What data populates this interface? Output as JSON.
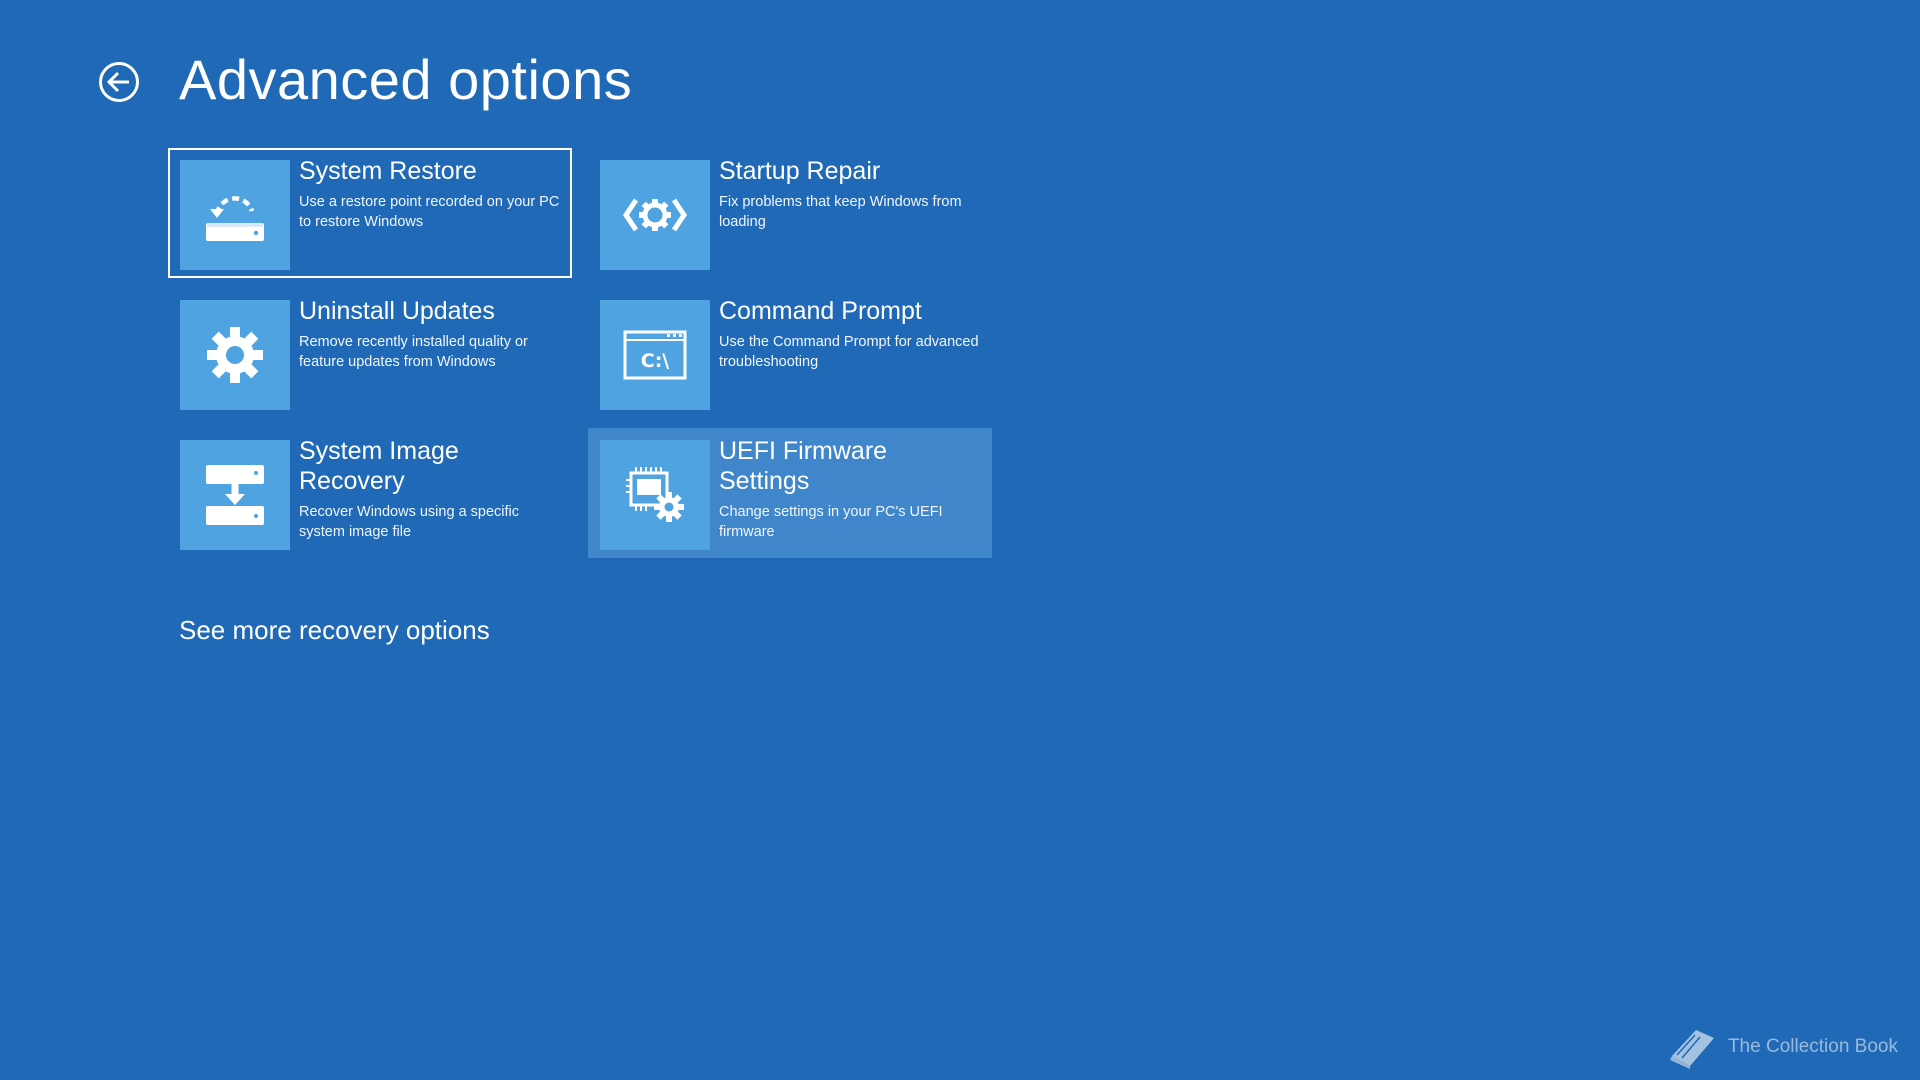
{
  "header": {
    "back_icon": "back-arrow-circle-icon",
    "title": "Advanced options"
  },
  "options": [
    {
      "title": "System Restore",
      "description": "Use a restore point recorded on your PC to restore Windows",
      "icon": "system-restore-icon",
      "state": "selected"
    },
    {
      "title": "Startup Repair",
      "description": "Fix problems that keep Windows from loading",
      "icon": "startup-repair-icon",
      "state": "normal"
    },
    {
      "title": "Uninstall Updates",
      "description": "Remove recently installed quality or feature updates from Windows",
      "icon": "gear-icon",
      "state": "normal"
    },
    {
      "title": "Command Prompt",
      "description": "Use the Command Prompt for advanced troubleshooting",
      "icon": "command-prompt-icon",
      "icon_text": "C:\\",
      "state": "normal"
    },
    {
      "title": "System Image Recovery",
      "description": "Recover Windows using a specific system image file",
      "icon": "system-image-recovery-icon",
      "state": "normal"
    },
    {
      "title": "UEFI Firmware Settings",
      "description": "Change settings in your PC's UEFI firmware",
      "icon": "uefi-firmware-icon",
      "state": "hovered"
    }
  ],
  "more_link": "See more recovery options",
  "watermark": {
    "text": "The Collection Book",
    "icon": "book-icon"
  },
  "colors": {
    "background": "#1f69b6",
    "tile_icon_background": "#4ea3e0",
    "hover_background": "#3f86cb",
    "text": "#ffffff"
  }
}
